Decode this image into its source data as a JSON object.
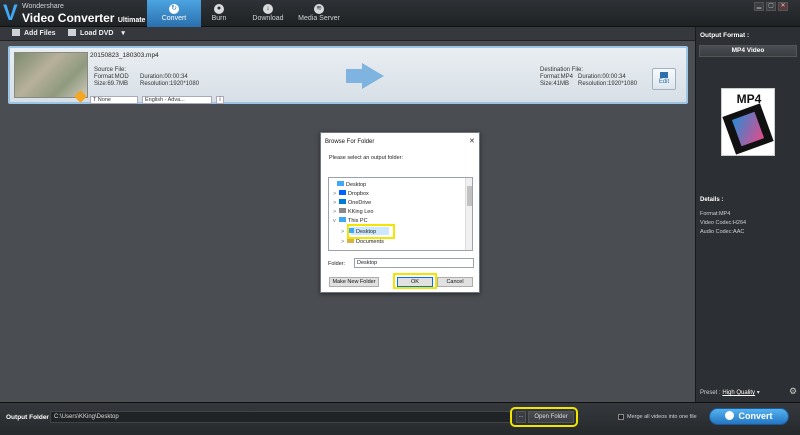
{
  "app": {
    "brand_small": "Wondershare",
    "brand_name": "Video Converter",
    "brand_edition": "Ultimate"
  },
  "nav": {
    "tabs": [
      {
        "label": "Convert",
        "active": true
      },
      {
        "label": "Burn",
        "active": false
      },
      {
        "label": "Download",
        "active": false
      },
      {
        "label": "Media Server",
        "active": false
      }
    ]
  },
  "window_controls": [
    "▁",
    "▢",
    "✕"
  ],
  "toolbar": {
    "add_files": "Add Files",
    "load_dvd": "Load DVD",
    "load_dvd_arrow": "▾"
  },
  "file": {
    "name": "20150823_180303.mp4",
    "source": {
      "heading": "Source File:",
      "format": "Format:MOD",
      "size": "Size:69.7MB",
      "duration": "Duration:00:00:34",
      "resolution": "Resolution:1920*1080"
    },
    "destination": {
      "heading": "Destination File:",
      "format": "Format:MP4",
      "size": "Size:41MB",
      "duration": "Duration:00:00:34",
      "resolution": "Resolution:1920*1080"
    },
    "edit_label": "Edit",
    "subtitle_select": "T None",
    "audio_select": "English - Adva...",
    "info_glyph": "i"
  },
  "right_panel": {
    "output_format_label": "Output Format :",
    "format_value": "MP4 Video",
    "format_icon_text": "MP4",
    "details_label": "Details :",
    "details": [
      "Format:MP4",
      "Video Codec:H264",
      "Audio Codec:AAC"
    ],
    "preset_label": "Preset :",
    "preset_value": "High Quality"
  },
  "bottom": {
    "output_folder_label": "Output Folder :",
    "output_path": "C:\\Users\\KKing\\Desktop",
    "browse_label": "...",
    "open_folder_label": "Open Folder",
    "merge_label": "Merge all videos into one file",
    "convert_label": "Convert"
  },
  "dialog": {
    "title": "Browse For Folder",
    "close": "✕",
    "prompt": "Please select an output folder:",
    "tree": [
      {
        "label": "Desktop",
        "caret": "",
        "color": "#3fa9f5"
      },
      {
        "label": "Dropbox",
        "caret": ">",
        "color": "#0061fe"
      },
      {
        "label": "OneDrive",
        "caret": ">",
        "color": "#0078d7"
      },
      {
        "label": "KKing Leo",
        "caret": ">",
        "color": "#888888"
      },
      {
        "label": "This PC",
        "caret": "v",
        "color": "#3fa9f5"
      },
      {
        "label": "Desktop",
        "caret": ">",
        "color": "#3fa9f5"
      },
      {
        "label": "Documents",
        "caret": ">",
        "color": "#d9b24a"
      }
    ],
    "folder_label": "Folder:",
    "folder_value": "Desktop",
    "make_new_folder": "Make New Folder",
    "ok": "OK",
    "cancel": "Cancel"
  },
  "colors": {
    "accent": "#2b6fae",
    "highlight": "#f2e600"
  }
}
